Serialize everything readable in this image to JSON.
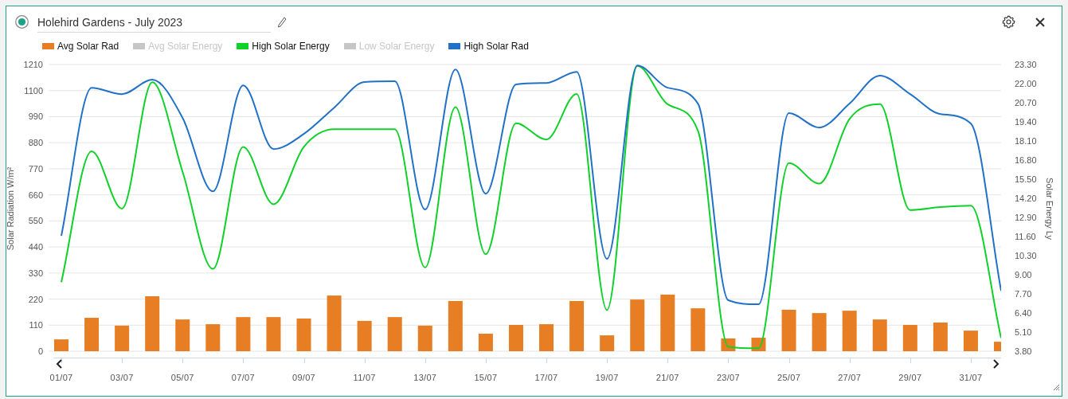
{
  "window": {
    "title": "Holehird Gardens - July 2023"
  },
  "legend": [
    {
      "label": "Avg Solar Rad",
      "color": "#e87e24",
      "visible": true
    },
    {
      "label": "Avg Solar Energy",
      "visible": false
    },
    {
      "label": "High Solar Energy",
      "color": "#10d12a",
      "visible": true
    },
    {
      "label": "Low Solar Energy",
      "visible": false
    },
    {
      "label": "High Solar Rad",
      "color": "#2171c7",
      "visible": true
    }
  ],
  "chart": {
    "chart_data": {
      "type": "bar",
      "ylabel": "Solar Radiation W/m²",
      "y2label": "Solar Energy Ly",
      "categories": [
        "01/07",
        null,
        "03/07",
        null,
        "05/07",
        null,
        "07/07",
        null,
        "09/07",
        null,
        "11/07",
        null,
        "13/07",
        null,
        "15/07",
        null,
        "17/07",
        null,
        "19/07",
        null,
        "21/07",
        null,
        "23/07",
        null,
        "25/07",
        null,
        "27/07",
        null,
        "29/07",
        null,
        "31/07",
        null
      ],
      "grid": true,
      "ylim": [
        0,
        1210
      ],
      "y2lim": [
        3.8,
        23.3
      ],
      "yticks": [
        0,
        110,
        220,
        330,
        440,
        550,
        660,
        770,
        880,
        990,
        1100,
        1210
      ],
      "y2ticks": [
        {
          "value": 3.8,
          "label": "3.80"
        },
        {
          "value": 5.1,
          "label": "5.10"
        },
        {
          "value": 6.4,
          "label": "6.40"
        },
        {
          "value": 7.7,
          "label": "7.70"
        },
        {
          "value": 9,
          "label": "9.00"
        },
        {
          "value": 10.3,
          "label": "10.30"
        },
        {
          "value": 11.6,
          "label": "11.60"
        },
        {
          "value": 12.9,
          "label": "12.90"
        },
        {
          "value": 14.2,
          "label": "14.20"
        },
        {
          "value": 15.5,
          "label": "15.50"
        },
        {
          "value": 16.8,
          "label": "16.80"
        },
        {
          "value": 18.1,
          "label": "18.10"
        },
        {
          "value": 19.4,
          "label": "19.40"
        },
        {
          "value": 20.7,
          "label": "20.70"
        },
        {
          "value": 22,
          "label": "22.00"
        },
        {
          "value": 23.3,
          "label": "23.30"
        }
      ],
      "series": [
        {
          "color": "#e87e24",
          "values": [
            50,
            141,
            108,
            232,
            134,
            114,
            144,
            144,
            138,
            235,
            128,
            144,
            108,
            212,
            74,
            111,
            114,
            212,
            67,
            218,
            239,
            181,
            54,
            57,
            175,
            161,
            171,
            134,
            111,
            121,
            87,
            40
          ]
        },
        {
          "type": "line",
          "axis": "y2",
          "color": "#10d12a",
          "values": [
            8.5,
            17.4,
            13.5,
            22.1,
            16.0,
            9.4,
            17.7,
            13.8,
            17.7,
            18.9,
            18.9,
            18.9,
            9.5,
            20.4,
            10.4,
            19.3,
            18.2,
            21.3,
            6.6,
            23.2,
            20.6,
            18.8,
            4.1,
            4.0,
            16.6,
            15.2,
            19.6,
            20.6,
            13.4,
            13.6,
            13.7,
            4.7
          ]
        },
        {
          "type": "line",
          "color": "#2171c7",
          "values": [
            487,
            1112,
            1085,
            1146,
            985,
            675,
            1122,
            853,
            917,
            1028,
            1136,
            1139,
            598,
            1189,
            665,
            1126,
            1132,
            1179,
            390,
            1206,
            1112,
            1045,
            215,
            198,
            1005,
            944,
            1045,
            1163,
            1085,
            1001,
            961,
            255
          ]
        }
      ]
    }
  }
}
